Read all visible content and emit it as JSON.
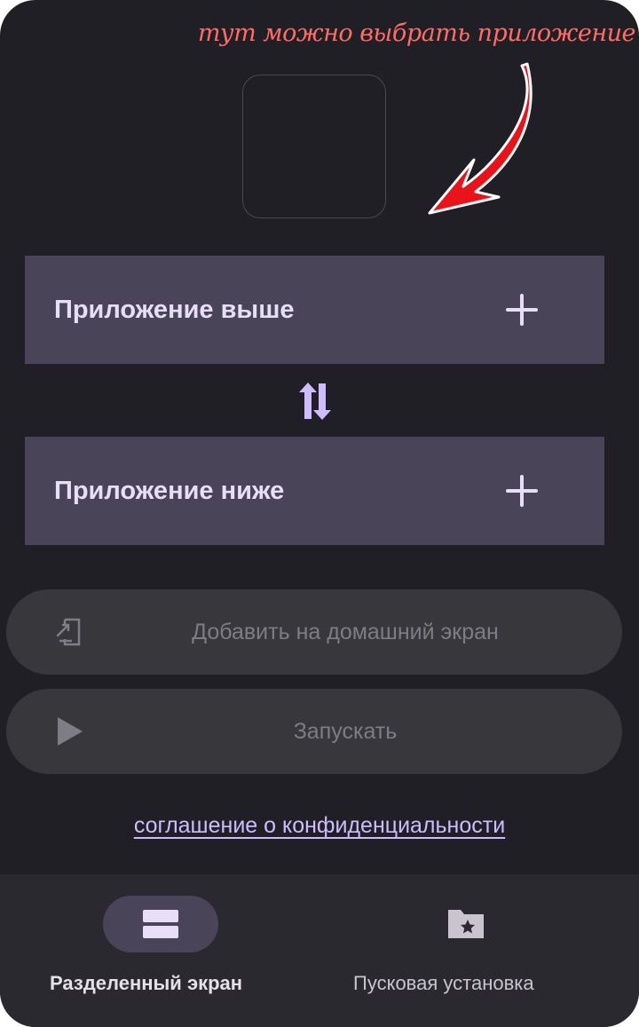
{
  "annotation": {
    "text": "тут можно выбрать приложение",
    "color": "#ff6b66"
  },
  "app_picker": {
    "icon": "empty-app-slot"
  },
  "slots": {
    "upper_label": "Приложение выше",
    "lower_label": "Приложение ниже",
    "add_icon": "plus-icon",
    "swap_icon": "swap-vertical-icon"
  },
  "actions": {
    "add_home": {
      "label": "Добавить на домашний экран",
      "icon": "add-to-home-icon",
      "enabled": false
    },
    "launch": {
      "label": "Запускать",
      "icon": "play-icon",
      "enabled": false
    }
  },
  "privacy_link": "соглашение о конфиденциальности",
  "bottom_nav": {
    "items": [
      {
        "label": "Разделенный экран",
        "icon": "split-screen-icon",
        "selected": true
      },
      {
        "label": "Пусковая установка",
        "icon": "folder-star-icon",
        "selected": false
      }
    ]
  },
  "colors": {
    "background": "#201f25",
    "accent": "#cfbcff",
    "slot_background": "#4a4458",
    "disabled_text": "#7e7c84",
    "annotation": "#ff6b66"
  }
}
